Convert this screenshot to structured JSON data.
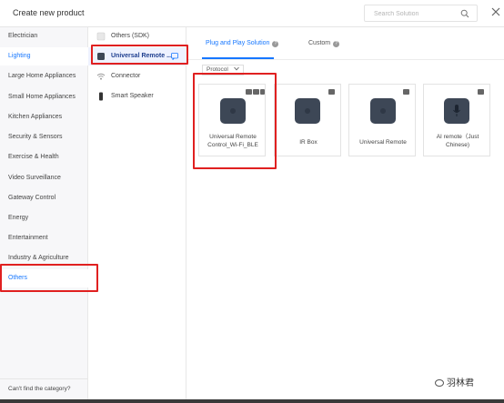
{
  "header": {
    "title": "Create new product",
    "search_placeholder": "Search Solution",
    "search_icon": "search-icon",
    "close_icon": "close-icon"
  },
  "categories": [
    "Electrician",
    "Lighting",
    "Large Home Appliances",
    "Small Home Appliances",
    "Kitchen Appliances",
    "Security & Sensors",
    "Exercise & Health",
    "Video Surveillance",
    "Gateway Control",
    "Energy",
    "Entertainment",
    "Industry & Agriculture",
    "Others"
  ],
  "categories_footer": "Can't find the category?",
  "subcategories": [
    {
      "label": "Others (SDK)",
      "icon": "box-icon"
    },
    {
      "label": "Universal Remote ...",
      "icon": "remote-icon"
    },
    {
      "label": "Connector",
      "icon": "wifi-icon"
    },
    {
      "label": "Smart Speaker",
      "icon": "speaker-icon"
    }
  ],
  "tabs": [
    {
      "label": "Plug and Play Solution"
    },
    {
      "label": "Custom"
    }
  ],
  "protocol_filter": "Protocol",
  "products": [
    {
      "name": "Universal Remote Control_Wi-Fi_BLE"
    },
    {
      "name": "IR Box"
    },
    {
      "name": "Universal Remote"
    },
    {
      "name": "AI remote（Just Chinese)"
    }
  ],
  "watermark": "羽林君",
  "colors": {
    "accent": "#1677ff",
    "highlight": "#e02020",
    "device": "#3d4756"
  }
}
